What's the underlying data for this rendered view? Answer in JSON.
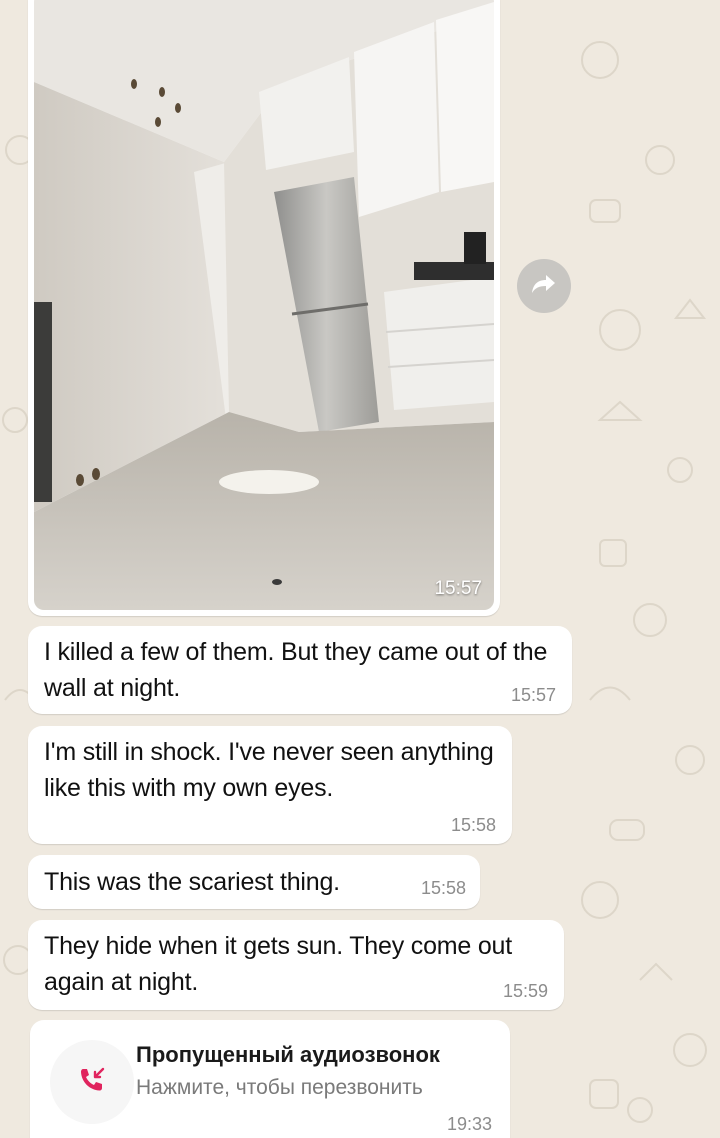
{
  "photo_message": {
    "time": "15:57"
  },
  "messages": [
    {
      "text": "I killed a few of them. But they came out of the wall at night.",
      "time": "15:57"
    },
    {
      "text": "I'm still in shock. I've never seen anything like this with my own eyes.",
      "time": "15:58"
    },
    {
      "text": "This was the scariest thing.",
      "time": "15:58"
    },
    {
      "text": "They hide when it gets sun. They come out again at night.",
      "time": "15:59"
    }
  ],
  "missed_call": {
    "title": "Пропущенный аудиозвонок",
    "subtitle": "Нажмите, чтобы перезвонить",
    "time": "19:33",
    "icon": "missed-call-icon",
    "icon_color": "#e0245e"
  },
  "forward_button": {
    "icon": "forward-arrow-icon"
  },
  "colors": {
    "chat_background": "#efe9df",
    "bubble": "#ffffff",
    "timestamp": "#8c8c8c"
  }
}
